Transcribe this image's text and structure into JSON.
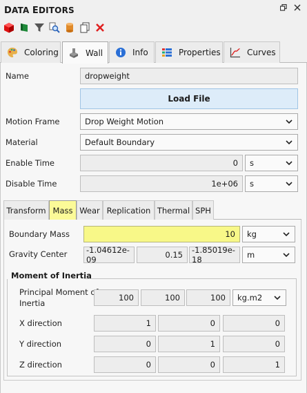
{
  "panel": {
    "title_first_letter": "D",
    "title_rest_1": "ATA ",
    "title_second_letter": "E",
    "title_rest_2": "DITORS"
  },
  "window_icons": [
    "undock-icon",
    "close-icon"
  ],
  "toolbar": [
    "red-cube-icon",
    "green-flag-icon",
    "funnel-icon",
    "find-icon",
    "cylinder-icon",
    "copy-icon",
    "delete-icon"
  ],
  "main_tabs": [
    {
      "label": "Coloring",
      "icon": "palette-icon",
      "active": false
    },
    {
      "label": "Wall",
      "icon": "wall-icon",
      "active": true
    },
    {
      "label": "Info",
      "icon": "info-icon",
      "active": false
    },
    {
      "label": "Properties",
      "icon": "properties-icon",
      "active": false
    },
    {
      "label": "Curves",
      "icon": "curves-icon",
      "active": false
    }
  ],
  "form": {
    "name_label": "Name",
    "name_value": "dropweight",
    "load_file_label": "Load File",
    "motion_frame_label": "Motion Frame",
    "motion_frame_value": "Drop Weight Motion",
    "material_label": "Material",
    "material_value": "Default Boundary",
    "enable_time_label": "Enable Time",
    "enable_time_value": "0",
    "enable_time_unit": "s",
    "disable_time_label": "Disable Time",
    "disable_time_value": "1e+06",
    "disable_time_unit": "s"
  },
  "sub_tabs": [
    {
      "label": "Transform",
      "active": false
    },
    {
      "label": "Mass",
      "active": true
    },
    {
      "label": "Wear",
      "active": false
    },
    {
      "label": "Replication",
      "active": false
    },
    {
      "label": "Thermal",
      "active": false
    },
    {
      "label": "SPH",
      "active": false
    }
  ],
  "mass": {
    "boundary_mass_label": "Boundary Mass",
    "boundary_mass_value": "10",
    "boundary_mass_unit": "kg",
    "gravity_center_label": "Gravity Center",
    "gravity_center_values": [
      "-1.04612e-09",
      "0.15",
      "-1.85019e-18"
    ],
    "gravity_center_unit": "m",
    "moi_group_title": "Moment of Inertia",
    "principal_label_line1": "Principal Moment of",
    "principal_label_line2": "Inertia",
    "principal_values": [
      "100",
      "100",
      "100"
    ],
    "principal_unit": "kg.m2",
    "x_direction_label": "X direction",
    "x_direction_values": [
      "1",
      "0",
      "0"
    ],
    "y_direction_label": "Y direction",
    "y_direction_values": [
      "0",
      "1",
      "0"
    ],
    "z_direction_label": "Z direction",
    "z_direction_values": [
      "0",
      "0",
      "1"
    ]
  },
  "colors": {
    "accent_blue": "#ddecf9",
    "active_subtab": "#fbfa98",
    "highlight_field": "#f8f888"
  }
}
